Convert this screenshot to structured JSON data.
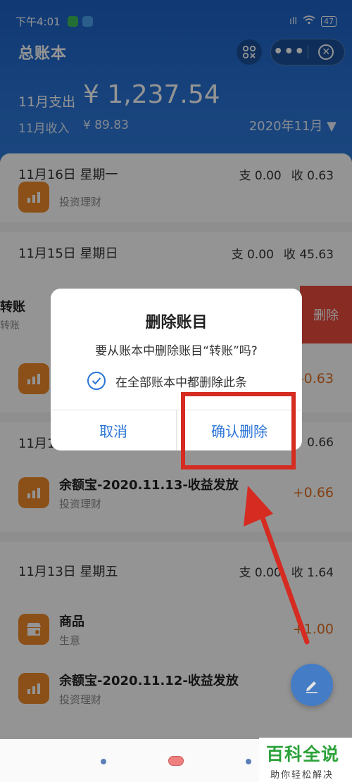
{
  "status_bar": {
    "time": "下午4:01",
    "signal": "ıll",
    "battery": "47"
  },
  "header": {
    "title": "总账本",
    "expense_label": "11月支出",
    "expense_amount": "¥ 1,237.54",
    "income_label": "11月收入",
    "income_amount": "¥ 89.83",
    "month_selector": "2020年11月 ▼"
  },
  "sections": [
    {
      "date": "11月16日 星期一",
      "expense": "支 0.00",
      "income": "收 0.63",
      "rows": [
        {
          "title": "",
          "category": "投资理财",
          "amount": ""
        }
      ]
    },
    {
      "date": "11月15日 星期日",
      "expense": "支 0.00",
      "income": "收 45.63",
      "swipe_row": {
        "title": "转账",
        "category": "转账",
        "delete_label": "删除"
      },
      "rows": [
        {
          "title": "",
          "category": "",
          "amount": "-0.63"
        }
      ]
    },
    {
      "date": "11月1",
      "expense": "",
      "income": "0.66",
      "rows": [
        {
          "title": "余额宝-2020.11.13-收益发放",
          "category": "投资理财",
          "amount": "+0.66"
        }
      ]
    },
    {
      "date": "11月13日 星期五",
      "expense": "支 0.00",
      "income": "收 1.64",
      "rows": [
        {
          "title": "商品",
          "category": "生意",
          "amount": "+1.00"
        },
        {
          "title": "余额宝-2020.11.12-收益发放",
          "category": "投资理财",
          "amount": ""
        }
      ]
    }
  ],
  "dialog": {
    "title": "删除账目",
    "message": "要从账本中删除账目“转账”吗?",
    "checkbox_label": "在全部账本中都删除此条",
    "checkbox_checked": true,
    "cancel_label": "取消",
    "confirm_label": "确认删除"
  },
  "watermark": {
    "main": "百科全说",
    "sub": "助你轻松解决"
  },
  "colors": {
    "primary": "#2a74d6",
    "accent_orange": "#f08a2a",
    "amount_orange": "#e26e1e",
    "delete_red": "#e84a3d",
    "annotation_red": "#d52b21",
    "watermark_green": "#2ca23a"
  },
  "icons": {
    "scan": "scan-icon",
    "more": "more-icon",
    "close": "close-icon",
    "chart": "chart-icon",
    "shop": "shop-icon",
    "check": "check-icon",
    "edit": "edit-icon",
    "arrow": "arrow-annotation"
  }
}
